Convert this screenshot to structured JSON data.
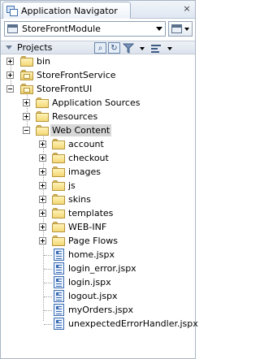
{
  "window": {
    "title": "Application Navigator",
    "icon": "application-navigator-icon",
    "close_icon": "close-icon"
  },
  "selector": {
    "value": "StoreFrontModule",
    "options_button_icon": "workspace-menu-icon"
  },
  "panel": {
    "title": "Projects",
    "toolbar_icons": [
      "find-icon",
      "refresh-icon",
      "filter-icon",
      "settings-icon"
    ]
  },
  "tree": {
    "projects": [
      {
        "label": "bin",
        "type": "folder",
        "expanded": false
      },
      {
        "label": "StoreFrontService",
        "type": "project",
        "expanded": false
      },
      {
        "label": "StoreFrontUI",
        "type": "project",
        "expanded": true,
        "children": [
          {
            "label": "Application Sources",
            "type": "folder",
            "expanded": false
          },
          {
            "label": "Resources",
            "type": "folder",
            "expanded": false
          },
          {
            "label": "Web Content",
            "type": "folder",
            "expanded": true,
            "selected": true,
            "children": [
              {
                "label": "account",
                "type": "folder"
              },
              {
                "label": "checkout",
                "type": "folder"
              },
              {
                "label": "images",
                "type": "folder"
              },
              {
                "label": "js",
                "type": "folder"
              },
              {
                "label": "skins",
                "type": "folder"
              },
              {
                "label": "templates",
                "type": "folder"
              },
              {
                "label": "WEB-INF",
                "type": "folder"
              },
              {
                "label": "Page Flows",
                "type": "folder"
              },
              {
                "label": "home.jspx",
                "type": "file"
              },
              {
                "label": "login_error.jspx",
                "type": "file"
              },
              {
                "label": "login.jspx",
                "type": "file"
              },
              {
                "label": "logout.jspx",
                "type": "file"
              },
              {
                "label": "myOrders.jspx",
                "type": "file"
              },
              {
                "label": "unexpectedErrorHandler.jspx",
                "type": "file"
              }
            ]
          }
        ]
      }
    ]
  },
  "colors": {
    "selection": "#d7d7d7",
    "folder": "#f3d776",
    "file_icon": "#3c6bb3",
    "border": "#a9b5c4"
  }
}
